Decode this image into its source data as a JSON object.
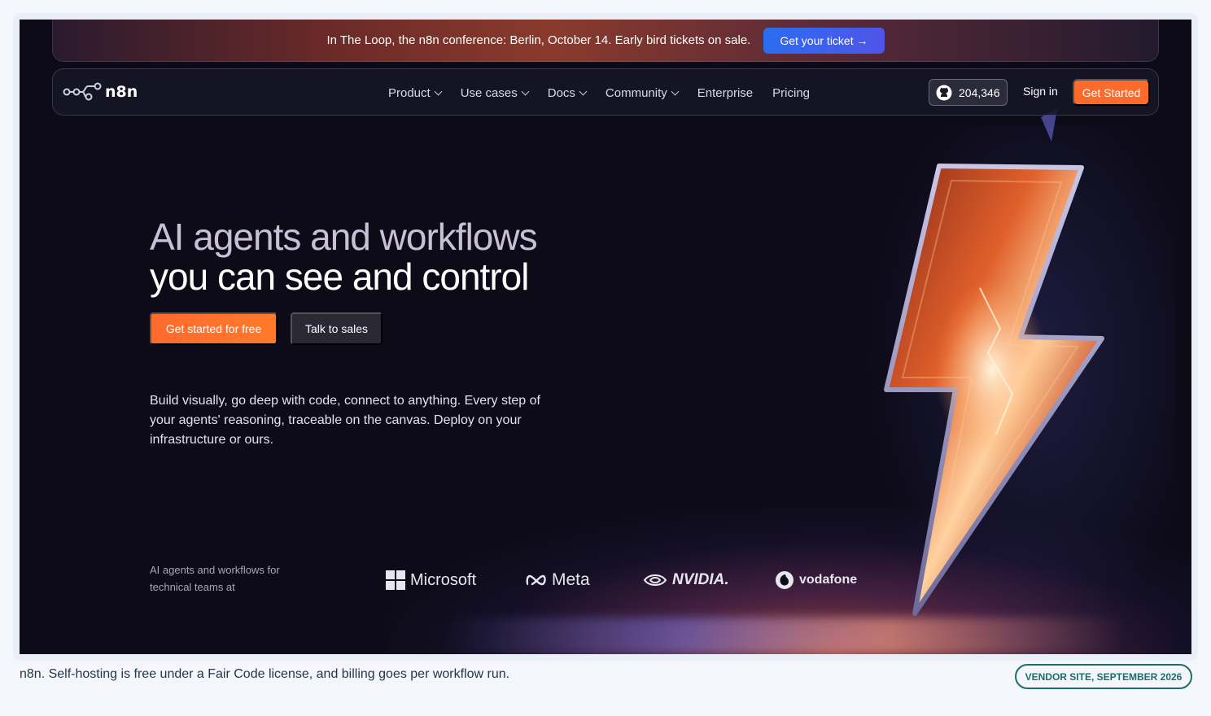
{
  "banner": {
    "text": "In The Loop, the n8n conference: Berlin, October 14. Early bird tickets on sale.",
    "button_label": "Get your ticket →"
  },
  "nav": {
    "logo_text": "n8n",
    "menu": [
      {
        "label": "Product",
        "has_dropdown": true
      },
      {
        "label": "Use cases",
        "has_dropdown": true
      },
      {
        "label": "Docs",
        "has_dropdown": true
      },
      {
        "label": "Community",
        "has_dropdown": true
      },
      {
        "label": "Enterprise",
        "has_dropdown": false
      },
      {
        "label": "Pricing",
        "has_dropdown": false
      }
    ],
    "github_stars": "204,346",
    "signin_label": "Sign in",
    "get_started_label": "Get Started"
  },
  "hero": {
    "headline_line1": "AI agents and workflows",
    "headline_line2": "you can see and control",
    "cta_primary": "Get started for free",
    "cta_secondary": "Talk to sales",
    "description": "Build visually, go deep with code, connect to anything. Every step of your agents' reasoning, traceable on the canvas. Deploy on your infrastructure or ours."
  },
  "trusted": {
    "label": "AI agents and workflows for technical teams at",
    "logos": [
      "Microsoft",
      "Meta",
      "NVIDIA.",
      "vodafone"
    ]
  },
  "footer": {
    "caption": "n8n. Self-hosting is free under a Fair Code license, and billing goes per workflow run.",
    "tag": "VENDOR SITE, SEPTEMBER 2026"
  },
  "colors": {
    "accent_orange": "#fe6a2c",
    "banner_button_blue": "#2b6cf0",
    "background": "#0d0b18",
    "tag_teal": "#1d6e68"
  }
}
